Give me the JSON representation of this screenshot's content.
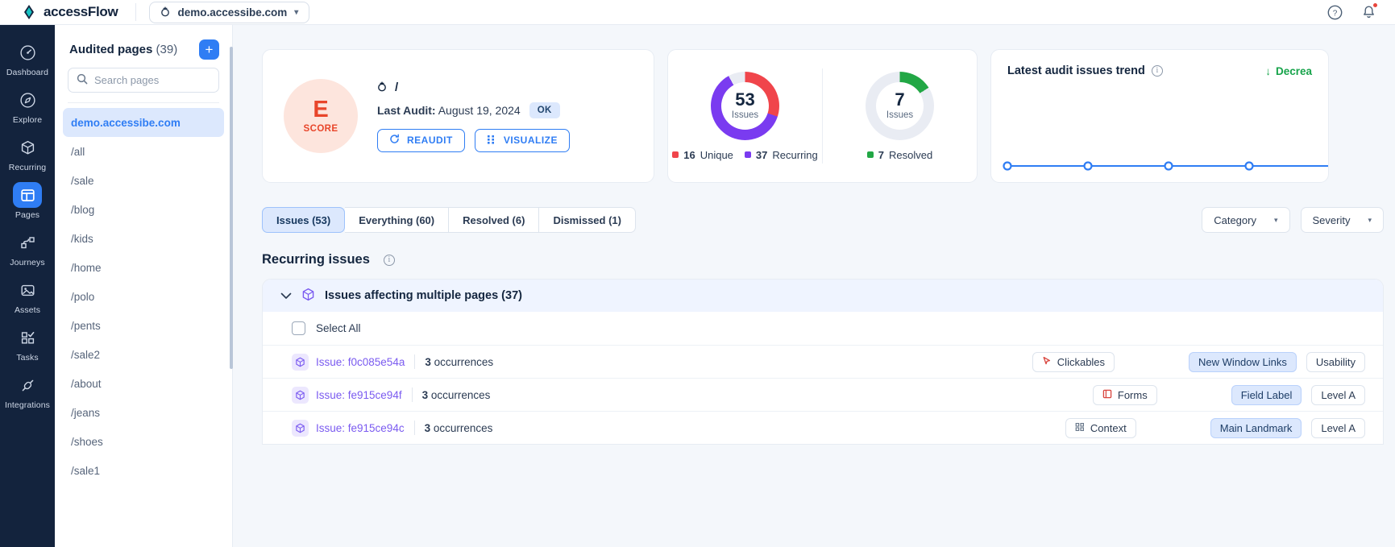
{
  "topbar": {
    "brand": "accessFlow",
    "domain": "demo.accessibe.com",
    "chevron": "▾",
    "help_icon": "help-circle-icon",
    "bell_icon": "bell-icon"
  },
  "rail": {
    "items": [
      {
        "label": "Dashboard",
        "icon": "gauge-icon",
        "active": false
      },
      {
        "label": "Explore",
        "icon": "compass-icon",
        "active": false
      },
      {
        "label": "Recurring",
        "icon": "cube-icon",
        "active": false
      },
      {
        "label": "Pages",
        "icon": "layout-icon",
        "active": true
      },
      {
        "label": "Journeys",
        "icon": "journey-icon",
        "active": false
      },
      {
        "label": "Assets",
        "icon": "image-icon",
        "active": false
      },
      {
        "label": "Tasks",
        "icon": "tasks-icon",
        "active": false
      },
      {
        "label": "Integrations",
        "icon": "plug-icon",
        "active": false
      }
    ]
  },
  "pages_panel": {
    "title": "Audited pages",
    "count": "(39)",
    "add_label": "+",
    "search_placeholder": "Search pages",
    "search_value": "",
    "items": [
      {
        "label": "demo.accessibe.com",
        "active": true
      },
      {
        "label": "/all",
        "active": false
      },
      {
        "label": "/sale",
        "active": false
      },
      {
        "label": "/blog",
        "active": false
      },
      {
        "label": "/kids",
        "active": false
      },
      {
        "label": "/home",
        "active": false
      },
      {
        "label": "/polo",
        "active": false
      },
      {
        "label": "/pents",
        "active": false
      },
      {
        "label": "/sale2",
        "active": false
      },
      {
        "label": "/about",
        "active": false
      },
      {
        "label": "/jeans",
        "active": false
      },
      {
        "label": "/shoes",
        "active": false
      },
      {
        "label": "/sale1",
        "active": false
      }
    ]
  },
  "score_card": {
    "grade": "E",
    "grade_word": "SCORE",
    "url_path": "/",
    "last_audit_label": "Last Audit:",
    "last_audit_date": "August 19, 2024",
    "status_badge": "OK",
    "reaudit_label": "REAUDIT",
    "visualize_label": "VISUALIZE"
  },
  "donuts": [
    {
      "total": "53",
      "unit": "Issues",
      "legend": [
        {
          "label": "Unique",
          "value": "16",
          "color": "#f0454b"
        },
        {
          "label": "Recurring",
          "value": "37",
          "color": "#7a3bf0"
        }
      ],
      "segments": [
        {
          "color": "#f0454b",
          "pct": 30
        },
        {
          "color": "#7a3bf0",
          "pct": 62
        },
        {
          "color": "#e9ecf3",
          "pct": 8
        }
      ]
    },
    {
      "total": "7",
      "unit": "Issues",
      "legend": [
        {
          "label": "Resolved",
          "value": "7",
          "color": "#22a745"
        }
      ],
      "segments": [
        {
          "color": "#22a745",
          "pct": 16
        },
        {
          "color": "#e9ecf3",
          "pct": 84
        }
      ]
    }
  ],
  "trend": {
    "title": "Latest audit issues trend",
    "info_icon": "info-icon",
    "delta_label": "Decrea",
    "delta_arrow": "↓",
    "delta_color": "#16a34a",
    "line_color": "#2f7df4",
    "points": [
      0,
      0,
      0,
      0
    ]
  },
  "tabs": [
    {
      "label": "Issues (53)",
      "active": true
    },
    {
      "label": "Everything (60)",
      "active": false
    },
    {
      "label": "Resolved (6)",
      "active": false
    },
    {
      "label": "Dismissed (1)",
      "active": false
    }
  ],
  "filters": [
    {
      "label": "Category",
      "chevron": "▾"
    },
    {
      "label": "Severity",
      "chevron": "▾"
    }
  ],
  "section": {
    "title": "Recurring issues",
    "info_icon": "info-icon",
    "group_title": "Issues affecting multiple pages (37)",
    "group_chevron": "⌄",
    "select_all": "Select All"
  },
  "issues": [
    {
      "id": "Issue: f0c085e54a",
      "occurrences_count": "3",
      "occurrences_label": "occurrences",
      "category": "Clickables",
      "category_icon": "cursor-icon",
      "tags": [
        {
          "label": "New Window Links",
          "highlight": true
        },
        {
          "label": "Usability",
          "highlight": false
        }
      ]
    },
    {
      "id": "Issue: fe915ce94f",
      "occurrences_count": "3",
      "occurrences_label": "occurrences",
      "category": "Forms",
      "category_icon": "form-icon",
      "tags": [
        {
          "label": "Field Label",
          "highlight": true
        },
        {
          "label": "Level A",
          "highlight": false
        }
      ]
    },
    {
      "id": "Issue: fe915ce94c",
      "occurrences_count": "3",
      "occurrences_label": "occurrences",
      "category": "Context",
      "category_icon": "context-icon",
      "tags": [
        {
          "label": "Main Landmark",
          "highlight": true
        },
        {
          "label": "Level A",
          "highlight": false
        }
      ]
    }
  ]
}
